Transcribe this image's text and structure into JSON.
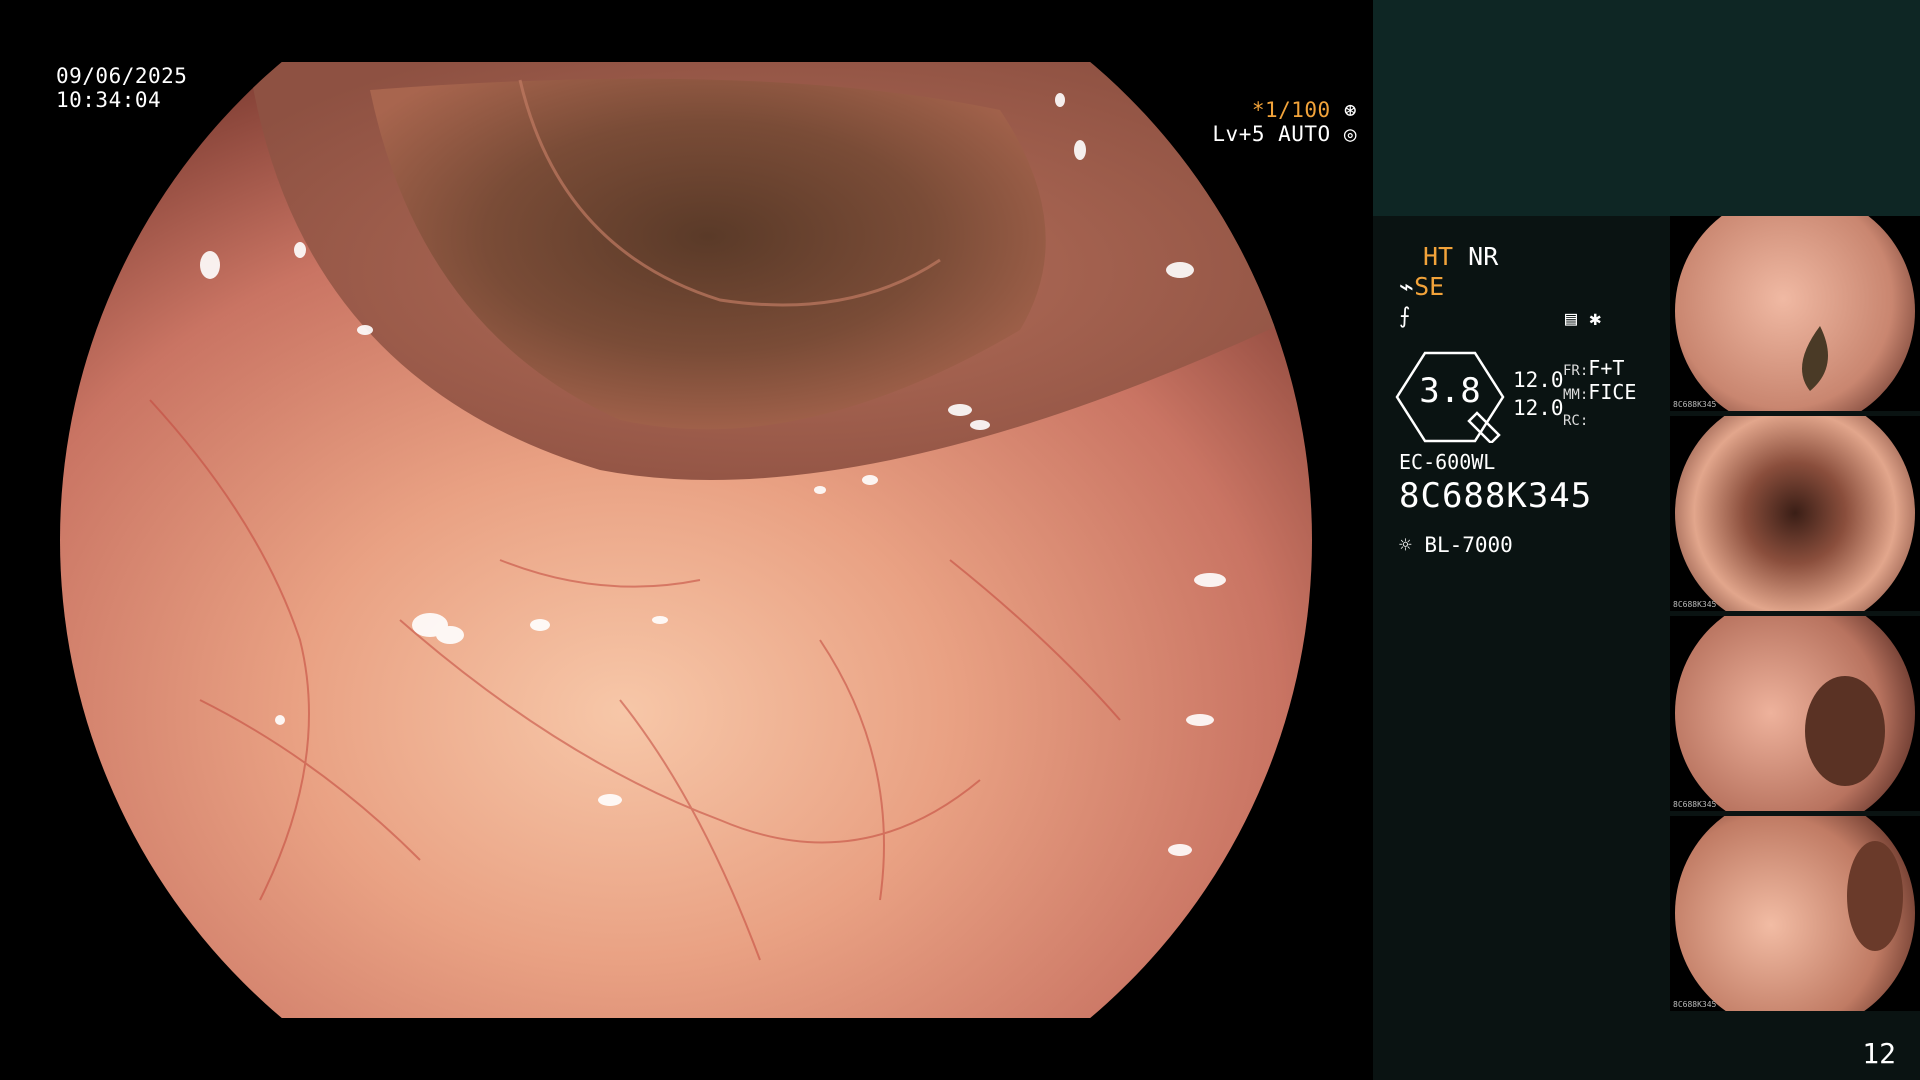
{
  "overlay": {
    "date": "09/06/2025",
    "time": "10:34:04",
    "shutter": "*1/100",
    "level": "Lv+5 AUTO"
  },
  "info": {
    "ht": "HT",
    "nr": "NR",
    "se": "SE",
    "zoom": "3.8",
    "values": [
      "12.0",
      "12.0"
    ],
    "fr_label": "FR:",
    "fr_value": "F+T",
    "mm_label": "MM:",
    "mm_value": "FICE",
    "rc_label": "RC:",
    "scope_model": "EC-600WL",
    "scope_serial": "8C688K345",
    "light_source": "BL-7000"
  },
  "thumbnails": [
    {
      "label": "8C688K345"
    },
    {
      "label": "8C688K345"
    },
    {
      "label": "8C688K345"
    },
    {
      "label": "8C688K345"
    }
  ],
  "page_number": "12",
  "colors": {
    "accent_orange": "#f2a33a",
    "panel_bg": "#0a1312",
    "top_strip_bg": "#0e2624"
  }
}
